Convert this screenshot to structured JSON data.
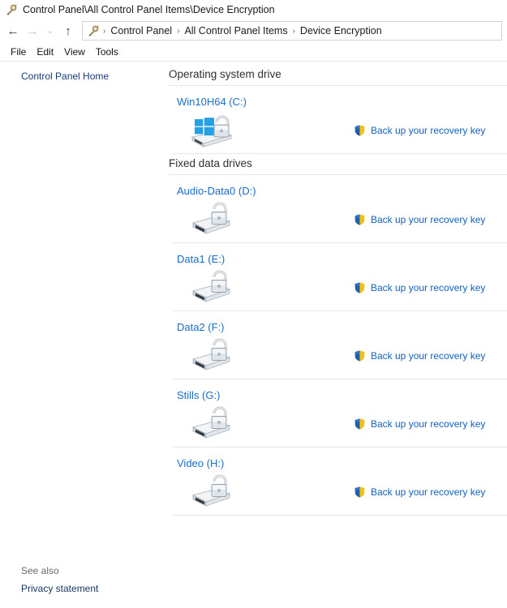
{
  "window": {
    "title": "Control Panel\\All Control Panel Items\\Device Encryption",
    "icon": "control-panel-icon"
  },
  "nav": {
    "back": "←",
    "forward": "→",
    "recent": "⌄",
    "up": "↑",
    "breadcrumb_icon": "control-panel-icon",
    "breadcrumbs": [
      "Control Panel",
      "All Control Panel Items",
      "Device Encryption"
    ],
    "separator": "›"
  },
  "menubar": {
    "items": [
      "File",
      "Edit",
      "View",
      "Tools"
    ]
  },
  "sidebar": {
    "home_label": "Control Panel Home",
    "see_also_label": "See also",
    "privacy_label": "Privacy statement"
  },
  "main": {
    "sections": [
      {
        "title": "Operating system drive",
        "drives": [
          {
            "name": "Win10H64 (C:)",
            "icon": "windows-drive-unlocked-icon",
            "action_label": "Back up your recovery key",
            "action_icon": "uac-shield-icon"
          }
        ]
      },
      {
        "title": "Fixed data drives",
        "drives": [
          {
            "name": "Audio-Data0 (D:)",
            "icon": "drive-unlocked-icon",
            "action_label": "Back up your recovery key",
            "action_icon": "uac-shield-icon"
          },
          {
            "name": "Data1 (E:)",
            "icon": "drive-unlocked-icon",
            "action_label": "Back up your recovery key",
            "action_icon": "uac-shield-icon"
          },
          {
            "name": "Data2 (F:)",
            "icon": "drive-unlocked-icon",
            "action_label": "Back up your recovery key",
            "action_icon": "uac-shield-icon"
          },
          {
            "name": "Stills (G:)",
            "icon": "drive-unlocked-icon",
            "action_label": "Back up your recovery key",
            "action_icon": "uac-shield-icon"
          },
          {
            "name": "Video (H:)",
            "icon": "drive-unlocked-icon",
            "action_label": "Back up your recovery key",
            "action_icon": "uac-shield-icon"
          }
        ]
      }
    ]
  },
  "colors": {
    "link_blue": "#1a6cc4",
    "action_blue": "#1560ba",
    "sidebar_link": "#1b3d73",
    "heading": "#303030",
    "separator": "#e8e8e8",
    "windows_logo": "#1b9ede",
    "shield_blue": "#1557a8",
    "shield_gold": "#f5c518"
  }
}
